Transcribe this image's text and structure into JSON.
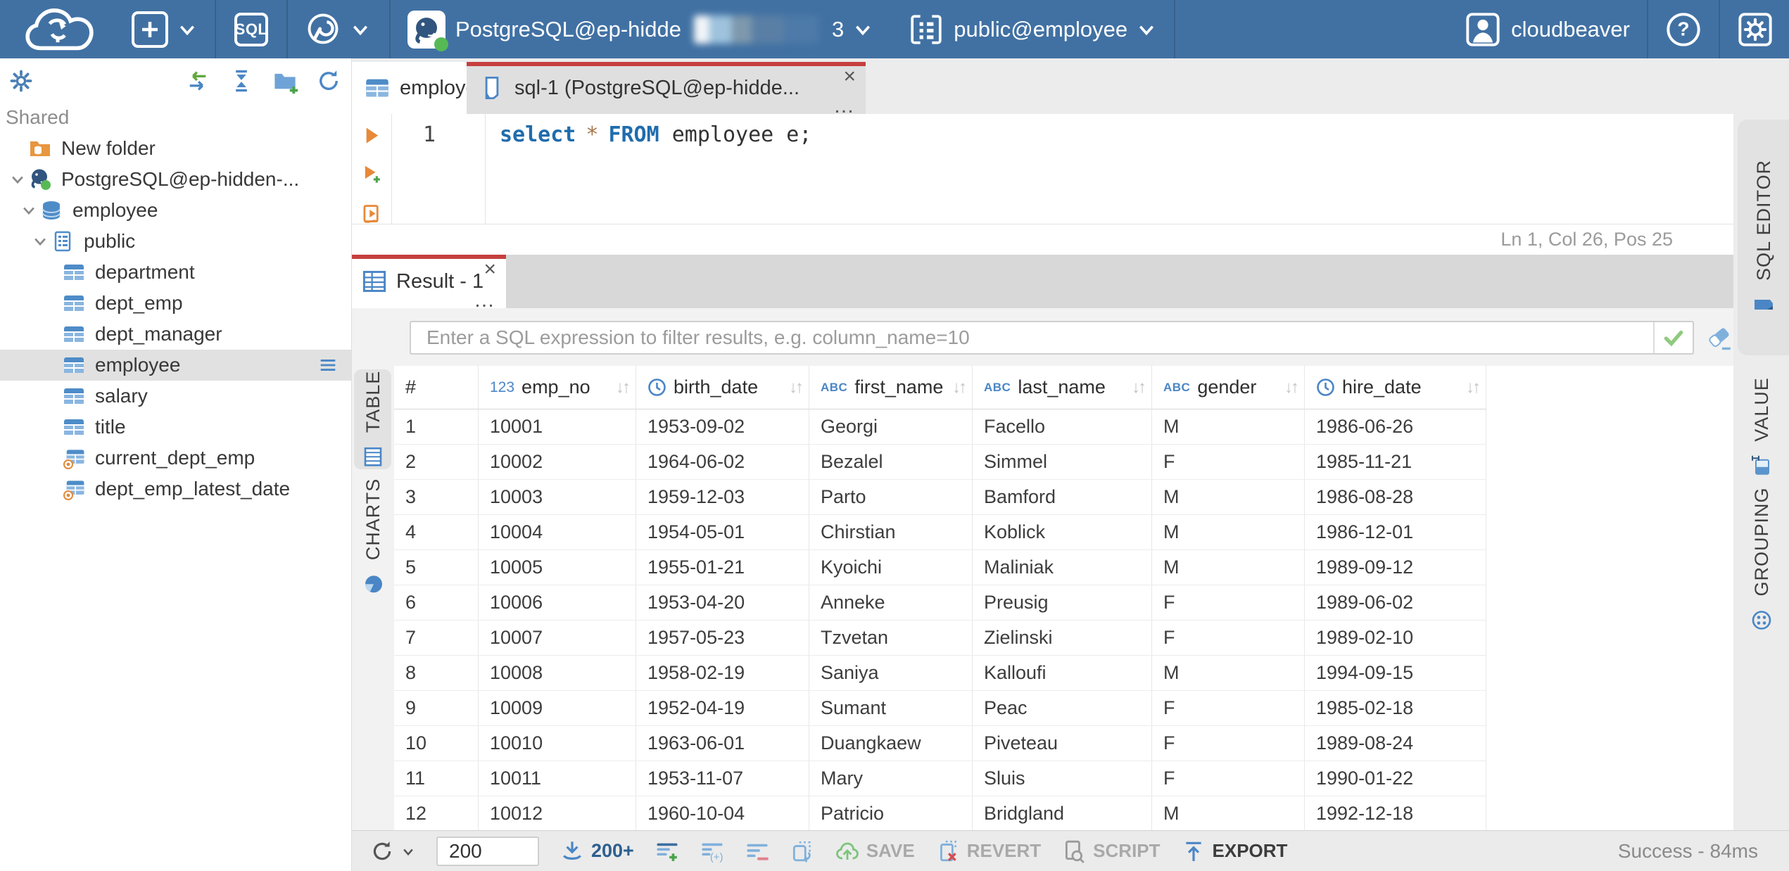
{
  "colors": {
    "topbar_blue": "#4171A3",
    "accent_red": "#C5403E",
    "icon_blue": "#4A86C6",
    "connection_status_green": "#57B956",
    "selected_row_gray": "#E1E1E1"
  },
  "header": {
    "logo": "cloudbeaver-logo",
    "sql_button_label": "SQL",
    "tool_icons": [
      "new-connection-icon",
      "sql-editor-icon",
      "driver-manager-icon"
    ],
    "connection": {
      "visible_name": "PostgreSQL@ep-hidde",
      "masked": true,
      "suffix": "3"
    },
    "schema_selector": "public@employee",
    "user_name": "cloudbeaver",
    "help_label": "?"
  },
  "sidebar": {
    "section_label": "Shared",
    "toolbar_icons": [
      "settings-gear-icon",
      "sync-connection-icon",
      "collapse-all-icon",
      "add-folder-icon",
      "refresh-icon"
    ],
    "items": [
      {
        "label": "New folder",
        "icon": "folder-database-icon",
        "depth": 0,
        "chevron": false
      },
      {
        "label": "PostgreSQL@ep-hidden-...",
        "icon": "postgresql-icon",
        "depth": 0,
        "chevron": true
      },
      {
        "label": "employee",
        "icon": "database-icon",
        "depth": 1,
        "chevron": true
      },
      {
        "label": "public",
        "icon": "schema-icon",
        "depth": 2,
        "chevron": true
      },
      {
        "label": "department",
        "icon": "table-icon",
        "depth": 3,
        "chevron": false
      },
      {
        "label": "dept_emp",
        "icon": "table-icon",
        "depth": 3,
        "chevron": false
      },
      {
        "label": "dept_manager",
        "icon": "table-icon",
        "depth": 3,
        "chevron": false
      },
      {
        "label": "employee",
        "icon": "table-icon",
        "depth": 3,
        "chevron": false,
        "selected": true
      },
      {
        "label": "salary",
        "icon": "table-icon",
        "depth": 3,
        "chevron": false
      },
      {
        "label": "title",
        "icon": "table-icon",
        "depth": 3,
        "chevron": false
      },
      {
        "label": "current_dept_emp",
        "icon": "view-icon",
        "depth": 3,
        "chevron": false
      },
      {
        "label": "dept_emp_latest_date",
        "icon": "view-icon",
        "depth": 3,
        "chevron": false
      }
    ]
  },
  "editor_tabs": [
    {
      "label": "employee",
      "icon": "table-icon",
      "active": false
    },
    {
      "label": "sql-1 (PostgreSQL@ep-hidde...",
      "icon": "sql-script-icon",
      "active": true,
      "close": "×",
      "more": "…"
    }
  ],
  "editor": {
    "line_number": "1",
    "code": {
      "kw1": "select",
      "star": "*",
      "kw2": "FROM",
      "tail": "employee e;"
    },
    "status": "Ln 1, Col 26, Pos 25",
    "side_tab_label": "SQL EDITOR"
  },
  "result": {
    "tab_label": "Result - 1",
    "tab_close": "×",
    "tab_more": "…",
    "filter_placeholder": "Enter a SQL expression to filter results, e.g. column_name=10",
    "left_tabs": [
      {
        "label": "TABLE",
        "icon": "table-grid-icon",
        "active": true
      },
      {
        "label": "CHARTS",
        "icon": "pie-chart-icon",
        "active": false
      }
    ],
    "right_tabs": [
      {
        "label": "VALUE",
        "icon": "value-panel-icon"
      },
      {
        "label": "GROUPING",
        "icon": "grouping-icon"
      }
    ],
    "grid": {
      "columns": [
        {
          "name": "#",
          "type": "index"
        },
        {
          "name": "emp_no",
          "type": "number"
        },
        {
          "name": "birth_date",
          "type": "date"
        },
        {
          "name": "first_name",
          "type": "string"
        },
        {
          "name": "last_name",
          "type": "string"
        },
        {
          "name": "gender",
          "type": "string"
        },
        {
          "name": "hire_date",
          "type": "date"
        }
      ],
      "sort_glyph": "↓↑",
      "number_type_glyph": "123",
      "string_type_glyph": "ABC",
      "rows": [
        [
          "1",
          "10001",
          "1953-09-02",
          "Georgi",
          "Facello",
          "M",
          "1986-06-26"
        ],
        [
          "2",
          "10002",
          "1964-06-02",
          "Bezalel",
          "Simmel",
          "F",
          "1985-11-21"
        ],
        [
          "3",
          "10003",
          "1959-12-03",
          "Parto",
          "Bamford",
          "M",
          "1986-08-28"
        ],
        [
          "4",
          "10004",
          "1954-05-01",
          "Chirstian",
          "Koblick",
          "M",
          "1986-12-01"
        ],
        [
          "5",
          "10005",
          "1955-01-21",
          "Kyoichi",
          "Maliniak",
          "M",
          "1989-09-12"
        ],
        [
          "6",
          "10006",
          "1953-04-20",
          "Anneke",
          "Preusig",
          "F",
          "1989-06-02"
        ],
        [
          "7",
          "10007",
          "1957-05-23",
          "Tzvetan",
          "Zielinski",
          "F",
          "1989-02-10"
        ],
        [
          "8",
          "10008",
          "1958-02-19",
          "Saniya",
          "Kalloufi",
          "M",
          "1994-09-15"
        ],
        [
          "9",
          "10009",
          "1952-04-19",
          "Sumant",
          "Peac",
          "F",
          "1985-02-18"
        ],
        [
          "10",
          "10010",
          "1963-06-01",
          "Duangkaew",
          "Piveteau",
          "F",
          "1989-08-24"
        ],
        [
          "11",
          "10011",
          "1953-11-07",
          "Mary",
          "Sluis",
          "F",
          "1990-01-22"
        ],
        [
          "12",
          "10012",
          "1960-10-04",
          "Patricio",
          "Bridgland",
          "M",
          "1992-12-18"
        ]
      ]
    },
    "toolbar": {
      "row_limit": "200",
      "fetch_more_label": "200+",
      "save_label": "SAVE",
      "revert_label": "REVERT",
      "script_label": "SCRIPT",
      "export_label": "EXPORT",
      "status": "Success - 84ms"
    }
  }
}
